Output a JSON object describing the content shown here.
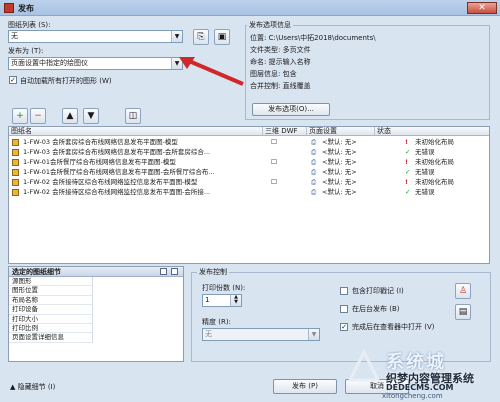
{
  "window": {
    "title": "发布",
    "close_glyph": "✕"
  },
  "sheet_list": {
    "label": "图纸列表 (S):",
    "value": "无"
  },
  "publish_to": {
    "label": "发布为 (T):",
    "value": "页面设置中指定的绘图仪"
  },
  "auto_load": {
    "label": "自动加载所有打开的图形 (W)",
    "checked": true
  },
  "publish_options_info": {
    "title": "发布选项信息",
    "location_label": "位置:",
    "location_value": "C:\\Users\\中拓2018\\documents\\",
    "filetype_label": "文件类型:",
    "filetype_value": "多页文件",
    "naming_label": "命名:",
    "naming_value": "提示输入名称",
    "layer_label": "图层信息:",
    "layer_value": "包含",
    "merge_label": "合并控制:",
    "merge_value": "直线覆盖",
    "button": "发布选项(O)..."
  },
  "sheet_table": {
    "columns": [
      "图纸名",
      "三维 DWF",
      "页面设置",
      "状态"
    ],
    "rows": [
      {
        "name": "1-FW-03 会所套房综合布线网络信息发布平面图-模型",
        "dwf": "☐",
        "setup": "<默认: 无>",
        "status": "未初始化布局",
        "ok": false
      },
      {
        "name": "1-FW-03 会所套房综合布线网络信息发布平面图-会所套房综合...",
        "dwf": "",
        "setup": "<默认: 无>",
        "status": "无错误",
        "ok": true
      },
      {
        "name": "1-FW-01会所餐厅综合布线网络信息发布平面图-模型",
        "dwf": "☐",
        "setup": "<默认: 无>",
        "status": "未初始化布局",
        "ok": false
      },
      {
        "name": "1-FW-01会所餐厅综合布线网络信息发布平面图-会所餐厅综合布...",
        "dwf": "",
        "setup": "<默认: 无>",
        "status": "无错误",
        "ok": true
      },
      {
        "name": "1-FW-02 会所接待区综合布线网络监控信息发布平面图-模型",
        "dwf": "☐",
        "setup": "<默认: 无>",
        "status": "未初始化布局",
        "ok": false
      },
      {
        "name": "1-FW-02 会所接待区综合布线网络监控信息发布平面图-会所接...",
        "dwf": "",
        "setup": "<默认: 无>",
        "status": "无错误",
        "ok": true
      }
    ]
  },
  "details": {
    "title": "选定的图纸细节",
    "rows": [
      "源图形",
      "图形位置",
      "布局名称",
      "打印设备",
      "打印大小",
      "打印比例",
      "页面设置详细信息"
    ]
  },
  "publish_control": {
    "title": "发布控制",
    "copies_label": "打印份数 (N):",
    "copies_value": "1",
    "precision_label": "精度 (R):",
    "precision_value": "无",
    "include_stamp": "包含打印戳记 (I)",
    "background": "在后台发布 (B)",
    "open_viewer": "完成后在查看器中打开 (V)"
  },
  "footer": {
    "hide_details": "隐藏细节 (I)",
    "publish_button": "发布 (P)",
    "cancel_button": "取消"
  },
  "watermark": {
    "brand": "系统城",
    "line1": "织梦内容管理系统",
    "line2": "DEDECMS.COM",
    "line3": "xitongcheng.com"
  },
  "colors": {
    "accent_red": "#d0282a",
    "ok_green": "#2a9a2a"
  }
}
